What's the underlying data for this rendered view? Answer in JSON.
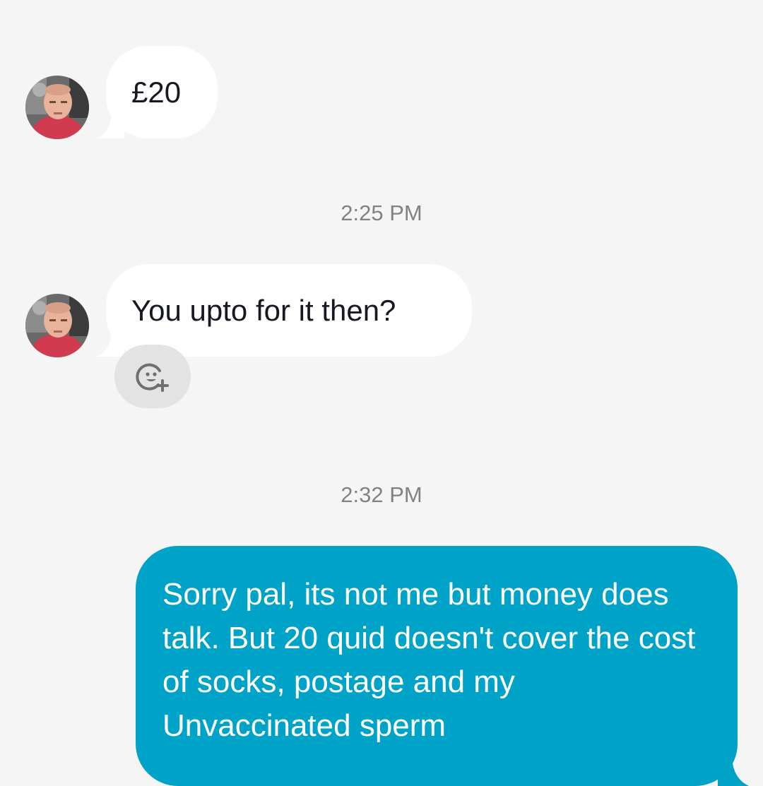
{
  "conversation": {
    "messages": [
      {
        "sender": "other",
        "text": "£20"
      },
      {
        "sender": "other",
        "text": "You upto for it then?"
      },
      {
        "sender": "me",
        "text": "Sorry pal, its not me but money does talk. But 20 quid doesn't cover the cost of socks, postage and my Unvaccinated sperm"
      }
    ],
    "timestamps": [
      "2:25 PM",
      "2:32 PM"
    ]
  },
  "icons": {
    "add_reaction": "add-reaction-icon"
  },
  "colors": {
    "background": "#f5f5f5",
    "incoming_bubble": "#ffffff",
    "outgoing_bubble": "#00a3c8",
    "timestamp_text": "#808287",
    "reaction_button": "#e3e3e3"
  }
}
